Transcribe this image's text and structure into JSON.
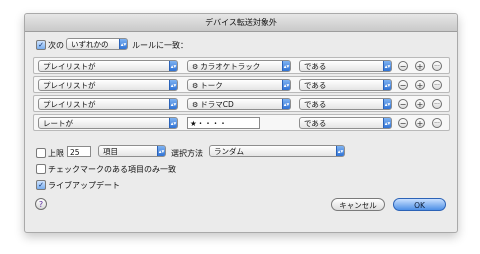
{
  "window": {
    "title": "デバイス転送対象外"
  },
  "match": {
    "prefix": "次の",
    "mode_value": "いずれかの",
    "suffix": "ルールに一致："
  },
  "rules": [
    {
      "field": "プレイリストが",
      "value": "カラオケトラック",
      "operator": "である",
      "value_has_gear": true
    },
    {
      "field": "プレイリストが",
      "value": "トーク",
      "operator": "である",
      "value_has_gear": true
    },
    {
      "field": "プレイリストが",
      "value": "ドラマCD",
      "operator": "である",
      "value_has_gear": true
    },
    {
      "field": "レートが",
      "value": "★・・・・",
      "operator": "である",
      "value_has_gear": false
    }
  ],
  "buttons": {
    "minus": "−",
    "plus": "+",
    "more": "···"
  },
  "limit": {
    "label": "上限",
    "value": "25",
    "unit": "項目",
    "method_label": "選択方法",
    "method_value": "ランダム"
  },
  "options": {
    "checked_only": "チェックマークのある項目のみ一致",
    "live_update": "ライブアップデート"
  },
  "footer": {
    "help": "?",
    "cancel": "キャンセル",
    "ok": "OK"
  },
  "checks": {
    "match_enabled": true,
    "limit_enabled": false,
    "checked_only": false,
    "live_update": true
  }
}
